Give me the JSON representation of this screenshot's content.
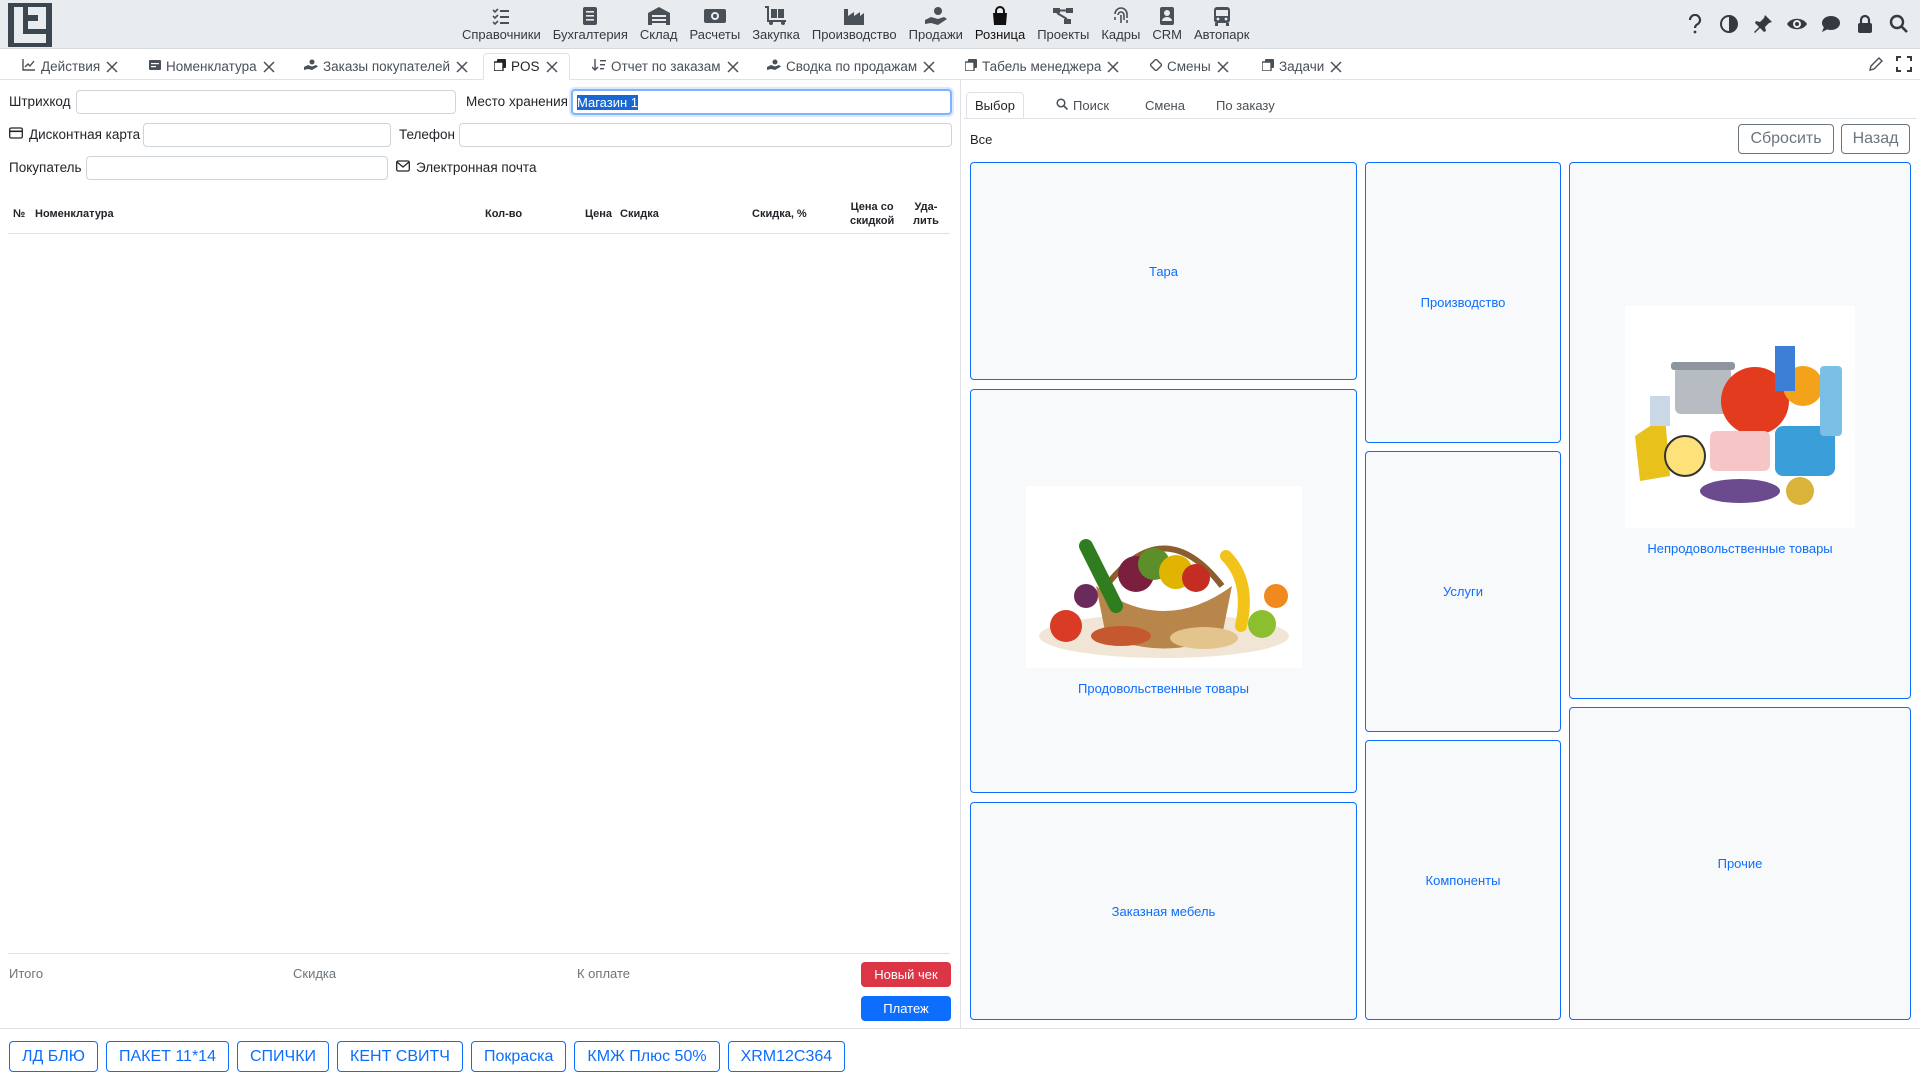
{
  "app": {
    "logo": "LS"
  },
  "modules": [
    {
      "label": "Справочники",
      "icon": "list-check-icon"
    },
    {
      "label": "Бухгалтерия",
      "icon": "ledger-icon"
    },
    {
      "label": "Склад",
      "icon": "warehouse-icon"
    },
    {
      "label": "Расчеты",
      "icon": "money-icon"
    },
    {
      "label": "Закупка",
      "icon": "cart-dolly-icon"
    },
    {
      "label": "Производство",
      "icon": "factory-icon"
    },
    {
      "label": "Продажи",
      "icon": "hand-coin-icon"
    },
    {
      "label": "Розница",
      "icon": "shopping-bag-icon"
    },
    {
      "label": "Проекты",
      "icon": "diagram-icon"
    },
    {
      "label": "Кадры",
      "icon": "fingerprint-icon"
    },
    {
      "label": "CRM",
      "icon": "contact-icon"
    },
    {
      "label": "Автопарк",
      "icon": "bus-icon"
    }
  ],
  "top_icons": [
    "help-icon",
    "contrast-icon",
    "pin-icon",
    "eye-icon",
    "chat-icon",
    "lock-icon",
    "search-icon"
  ],
  "tabs": [
    {
      "label": "Действия",
      "icon": "chart-line-icon"
    },
    {
      "label": "Номенклатура",
      "icon": "nomenclature-icon"
    },
    {
      "label": "Заказы покупателей",
      "icon": "hand-coin-icon"
    },
    {
      "label": "POS",
      "icon": "copy-icon"
    },
    {
      "label": "Отчет по заказам",
      "icon": "sort-icon"
    },
    {
      "label": "Сводка по продажам",
      "icon": "hand-coin-icon"
    },
    {
      "label": "Табель менеджера",
      "icon": "copy-icon"
    },
    {
      "label": "Смены",
      "icon": "diamond-icon"
    },
    {
      "label": "Задачи",
      "icon": "copy-icon"
    }
  ],
  "form": {
    "barcode_label": "Штрихкод",
    "barcode_value": "",
    "storage_label": "Место хранения",
    "storage_value": "Магазин 1",
    "discount_card_label": "Дисконтная карта",
    "discount_card_value": "",
    "phone_label": "Телефон",
    "phone_value": "",
    "buyer_label": "Покупатель",
    "buyer_value": "",
    "email_label": "Электронная почта"
  },
  "table": {
    "headers": {
      "num": "№",
      "item": "Номенклатура",
      "qty": "Кол-во",
      "price": "Цена",
      "discount": "Скидка",
      "discount_pct": "Скидка, %",
      "price_disc_1": "Цена со",
      "price_disc_2": "скидкой",
      "del_1": "Уда-",
      "del_2": "лить"
    },
    "rows": []
  },
  "totals": {
    "total_label": "Итого",
    "discount_label": "Скидка",
    "to_pay_label": "К оплате",
    "new_check": "Новый чек",
    "payment": "Платеж"
  },
  "right": {
    "tabs": [
      "Выбор",
      "Поиск",
      "Смена",
      "По заказу"
    ],
    "breadcrumb": "Все",
    "reset": "Сбросить",
    "back": "Назад",
    "categories": {
      "tara": "Тара",
      "food": "Продовольственные товары",
      "furniture": "Заказная мебель",
      "production": "Производство",
      "services": "Услуги",
      "components": "Компоненты",
      "nonfood": "Непродовольственные товары",
      "other": "Прочие"
    }
  },
  "quick_buttons": [
    "ЛД БЛЮ",
    "ПАКЕТ 11*14",
    "СПИЧКИ",
    "КЕНТ СВИТЧ",
    "Покраска",
    "КМЖ Плюс 50%",
    "XRM12C364"
  ],
  "colors": {
    "accent": "#0d6efd",
    "danger": "#dc3545",
    "topbar": "#e9ecef"
  }
}
